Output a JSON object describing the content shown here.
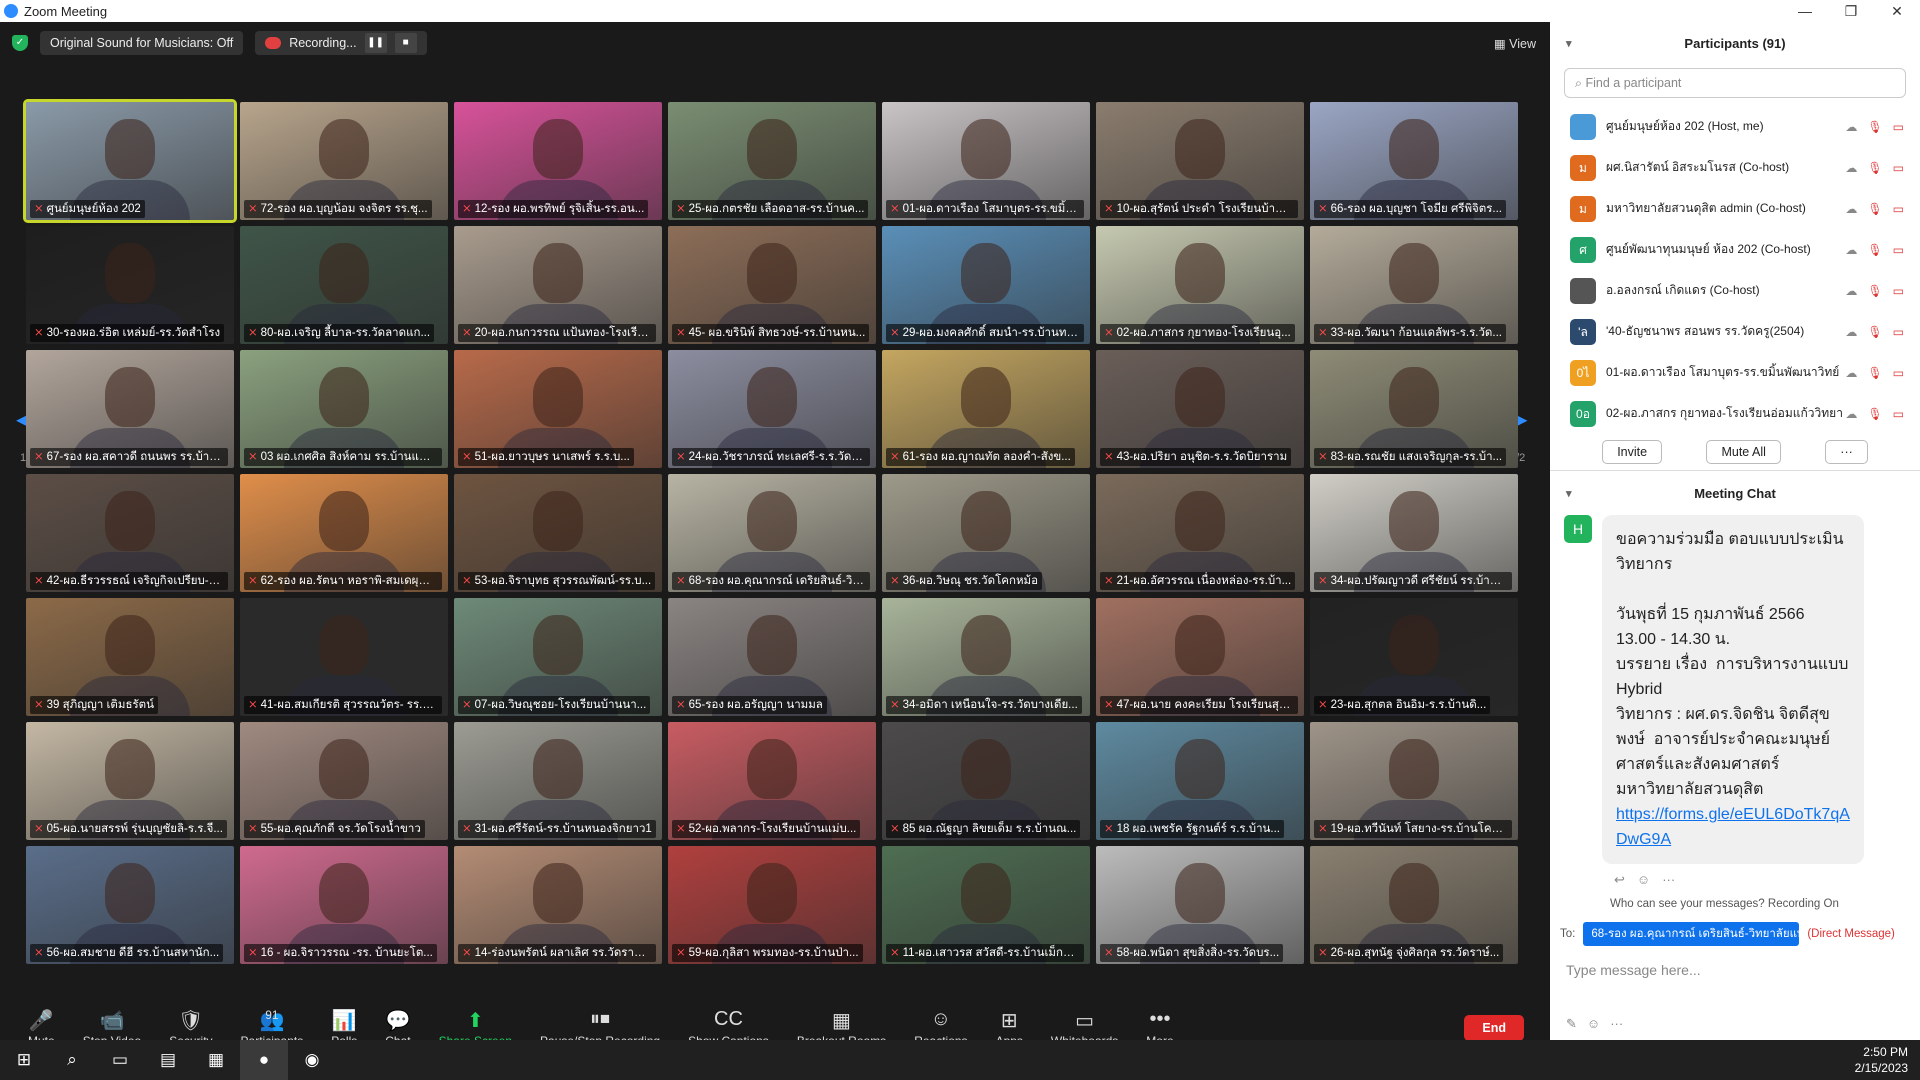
{
  "window": {
    "title": "Zoom Meeting",
    "controls": [
      "—",
      "❐",
      "✕"
    ]
  },
  "topbar": {
    "original_sound": "Original Sound for Musicians: Off",
    "recording": "Recording...",
    "pause_icon": "❚❚",
    "stop_icon": "■",
    "view": "View"
  },
  "pager": {
    "left": "1/2",
    "right": "1/2"
  },
  "tiles": [
    {
      "label": "ศูนย์มนุษย์ห้อง 202",
      "color": "#8a9aa8",
      "active": true
    },
    {
      "label": "72-รอง ผอ.บุญน้อม จงจิตร รร.ชุ...",
      "color": "#b8a58c"
    },
    {
      "label": "12-รอง ผอ.พรทิพย์ รุจิเสิ้น-รร.อน...",
      "color": "#d8529a"
    },
    {
      "label": "25-ผอ.กตรชัย เลือดอาส-รร.บ้านค...",
      "color": "#7a8e72"
    },
    {
      "label": "01-ผอ.ดาวเรือง โสมาบุตร-รร.ขมิ้น...",
      "color": "#c9c4c6"
    },
    {
      "label": "10-ผอ.สุรัตน์ ประดำ โรงเรียนบ้านใ...",
      "color": "#8b7d6e"
    },
    {
      "label": "66-รอง ผอ.บุญชา โจมีย ศรีพิจิตร...",
      "color": "#9aa6c4"
    },
    {
      "label": "30-รองผอ.ร่อิต เหล่มย์-รร.วัดสำโรง",
      "color": "#1e1e1e"
    },
    {
      "label": "80-ผอ.เจริญ ลี้บาล-รร.วัดลาดแก...",
      "color": "#3f5548"
    },
    {
      "label": "20-ผอ.กนกวรรณ แป้นทอง-โรงเรีย...",
      "color": "#a99c8e"
    },
    {
      "label": "45- ผอ.ขรินิพ์ สิทธวงษ์-รร.บ้านหน...",
      "color": "#8d6e58"
    },
    {
      "label": "29-ผอ.มงคลศักดิ์ สมนำ-รร.บ้านทรเม...",
      "color": "#5a8fb8"
    },
    {
      "label": "02-ผอ.ภาสกร กุยาทอง-โรงเรียนอุ...",
      "color": "#c6c9b0"
    },
    {
      "label": "33-ผอ.วัฒนา ก้อนแดลัพร-ร.ร.วัด...",
      "color": "#b4ab9a"
    },
    {
      "label": "67-รอง ผอ.สคาวดี ถนนพร รร.บ้านท...",
      "color": "#b2a69c"
    },
    {
      "label": "03 ผอ.เกศศิล สิงห์คาม รร.บ้านแพง...",
      "color": "#8aa17e"
    },
    {
      "label": "51-ผอ.ยาวบุษร นาเสพร์ ร.ร.บ...",
      "color": "#b86a4a"
    },
    {
      "label": "24-ผอ.วัชราภรณ์ ทะเลศรี-ร.ร.วัดใน...",
      "color": "#8c8ea0"
    },
    {
      "label": "61-รอง ผอ.ญาณทัต ลองคำ-สังข...",
      "color": "#c4a660"
    },
    {
      "label": "43-ผอ.ปริยา อนุชิต-ร.ร.วัดบิยาราม",
      "color": "#6a5e58"
    },
    {
      "label": "83-ผอ.รณชัย แสงเจริญกุล-รร.บ้า...",
      "color": "#8e8c76"
    },
    {
      "label": "42-ผอ.ธีรวรรธณ์ เจริญกิจเปรียบ-ร...",
      "color": "#5c4e46"
    },
    {
      "label": "62-รอง ผอ.รัตนา หอราพิ-สมเดผุณค...",
      "color": "#e08e4a"
    },
    {
      "label": "53-ผอ.จิราบุทธ สุวรรณพัฒน์-รร.บ...",
      "color": "#6e5440"
    },
    {
      "label": "68-รอง ผอ.คุณากรณ์ เดริยสินธ์-วิท...",
      "color": "#b8b4a4"
    },
    {
      "label": "36-ผอ.วิษณุ ชร.วัดโคกหม้อ",
      "color": "#9e9a8a"
    },
    {
      "label": "21-ผอ.อัศวรรณ เนื่องหล่อง-รร.บ้า...",
      "color": "#7a6a5a"
    },
    {
      "label": "34-ผอ.ปรัฒญาวดี ศรีชัยน์ รร.บ้านส...",
      "color": "#d0cec6"
    },
    {
      "label": "39 สุภิญญา เติมธรัตน์",
      "color": "#8c6a48"
    },
    {
      "label": "41-ผอ.สมเกียรติ สุวรรณวัตร- รร.บ้...",
      "color": "#2a2a2a"
    },
    {
      "label": "07-ผอ.วิษณุชอย-โรงเรียนบ้านนา...",
      "color": "#6e8a78"
    },
    {
      "label": "65-รอง ผอ.อรัญญา นามมล",
      "color": "#8a8482"
    },
    {
      "label": "34-อมิดา เหนือนใจ-รร.วัดบางเดีย...",
      "color": "#a8b49a"
    },
    {
      "label": "47-ผอ.นาย คงคะเรียม โรงเรียนสุรัส...",
      "color": "#a07060"
    },
    {
      "label": "23-ผอ.สุกตล อินอิม-ร.ร.บ้านดิ...",
      "color": "#222222"
    },
    {
      "label": "05-ผอ.นายสรรพ์ รุ่นบุญชัยลิ-ร.ร.จี...",
      "color": "#c4b8a4"
    },
    {
      "label": "55-ผอ.คุณภักดี จร.วัดโรงน้ำขาว",
      "color": "#a08a80"
    },
    {
      "label": "31-ผอ.ศรีรัตน์-รร.บ้านหนองจิกยาว1",
      "color": "#9c9c94"
    },
    {
      "label": "52-ผอ.พลากร-โรงเรียนบ้านแม่บ...",
      "color": "#c85c62"
    },
    {
      "label": "85 ผอ.ณัฐญา ลิขยเด็ม ร.ร.บ้านณ...",
      "color": "#4c4a4a"
    },
    {
      "label": "18 ผอ.เพชรัค รัฐกนต์ร์ ร.ร.บ้าน...",
      "color": "#5e8aa0"
    },
    {
      "label": "19-ผอ.ทวีนันท์ โสยาง-รร.บ้านโคกศรี",
      "color": "#9e9488"
    },
    {
      "label": "56-ผอ.สมชาย ดีฮี รร.บ้านสหานัก...",
      "color": "#5a6e8a"
    },
    {
      "label": "16 - ผอ.จิราวรรณ -รร. บ้านยะโต...",
      "color": "#d06a8e"
    },
    {
      "label": "14-ร่องนพรัตน์ ผลาเลิศ รร.วัดราษฎ...",
      "color": "#b48c74"
    },
    {
      "label": "59-ผอ.กุลิสา พรมทอง-รร.บ้านป่า...",
      "color": "#b0403e"
    },
    {
      "label": "11-ผอ.เสาวรส สวัสดี-รร.บ้านเม็กยาว",
      "color": "#4e6e52"
    },
    {
      "label": "58-ผอ.พนิดา สุขสิ่งสิ่ง-รร.วัดบร...",
      "color": "#bcbcbc"
    },
    {
      "label": "26-ผอ.สุทนัฐ จุ่งศิลกุล รร.วัดราษ์...",
      "color": "#8a8070"
    }
  ],
  "toolbar": [
    {
      "icon": "🎤",
      "label": "Mute",
      "name": "mute-button"
    },
    {
      "icon": "📹",
      "label": "Stop Video",
      "name": "stop-video-button"
    },
    {
      "icon": "🛡",
      "label": "Security",
      "name": "security-button"
    },
    {
      "icon": "👥",
      "label": "Participants",
      "name": "participants-button",
      "count": "91"
    },
    {
      "icon": "📊",
      "label": "Polls",
      "name": "polls-button"
    },
    {
      "icon": "💬",
      "label": "Chat",
      "name": "chat-button"
    },
    {
      "icon": "⬆",
      "label": "Share Screen",
      "name": "share-screen-button"
    },
    {
      "icon": "⏸⏹",
      "label": "Pause/Stop Recording",
      "name": "pause-stop-recording-button"
    },
    {
      "icon": "CC",
      "label": "Show Captions",
      "name": "show-captions-button"
    },
    {
      "icon": "▦",
      "label": "Breakout Rooms",
      "name": "breakout-rooms-button"
    },
    {
      "icon": "☺",
      "label": "Reactions",
      "name": "reactions-button"
    },
    {
      "icon": "⊞",
      "label": "Apps",
      "name": "apps-button"
    },
    {
      "icon": "▭",
      "label": "Whiteboards",
      "name": "whiteboards-button"
    },
    {
      "icon": "•••",
      "label": "More",
      "name": "more-button"
    }
  ],
  "end_label": "End",
  "participants_panel": {
    "title": "Participants (91)",
    "search_placeholder": "Find a participant",
    "invite": "Invite",
    "mute_all": "Mute All",
    "more": "···",
    "rows": [
      {
        "name": "ศูนย์มนุษย์ห้อง 202 (Host, me)",
        "initial": "",
        "color": "#4a9ad8"
      },
      {
        "name": "ผศ.นิสารัตน์ อิสระมโนรส (Co-host)",
        "initial": "ม",
        "color": "#e06a1e"
      },
      {
        "name": "มหาวิทยาลัยสวนดุสิต admin (Co-host)",
        "initial": "ม",
        "color": "#e06a1e"
      },
      {
        "name": "ศูนย์พัฒนาทุนมนุษย์ ห้อง 202 (Co-host)",
        "initial": "ศ",
        "color": "#23a36a"
      },
      {
        "name": "อ.อลงกรณ์ เกิดแดร (Co-host)",
        "initial": "",
        "color": "#555555"
      },
      {
        "name": "'40-ธัญชนาพร  สอนพร รร.วัดครู(2504)",
        "initial": "'ล",
        "color": "#2c4a6e"
      },
      {
        "name": "01-ผอ.ดาวเรือง โสมาบุตร-รร.ขมิ้นพัฒนาวิทย์",
        "initial": "0ไ",
        "color": "#f0a020"
      },
      {
        "name": "02-ผอ.ภาสกร กุยาทอง-โรงเรียนอ่อมแก้ววิทยา",
        "initial": "0อ",
        "color": "#23a36a"
      }
    ]
  },
  "chat_panel": {
    "title": "Meeting Chat",
    "sender_initial": "H",
    "message": "ขอความร่วมมือ ตอบแบบประเมินวิทยากร\n\nวันพุธที่ 15 กุมภาพันธ์ 2566\n13.00 - 14.30 น.\nบรรยาย เรื่อง  การบริหารงานแบบ Hybrid\nวิทยากร : ผศ.ดร.จิดชิน จิตดีสุขพงษ์  อาจารย์ประจำคณะมนุษย์ศาสตร์และสังคมศาสตร์ มหาวิทยาลัยสวนดุสิต",
    "link": "https://forms.gle/eEUL6DoTk7qADwG9A",
    "who_can_see": "Who can see your messages? Recording On",
    "to_label": "To:",
    "to_value": "68-รอง ผอ.คุณากรณ์ เดริยสินธ์-วิทยาลัยแทค...",
    "direct": "(Direct Message)",
    "placeholder": "Type message here..."
  },
  "taskbar": {
    "time": "2:50 PM",
    "date": "2/15/2023"
  }
}
